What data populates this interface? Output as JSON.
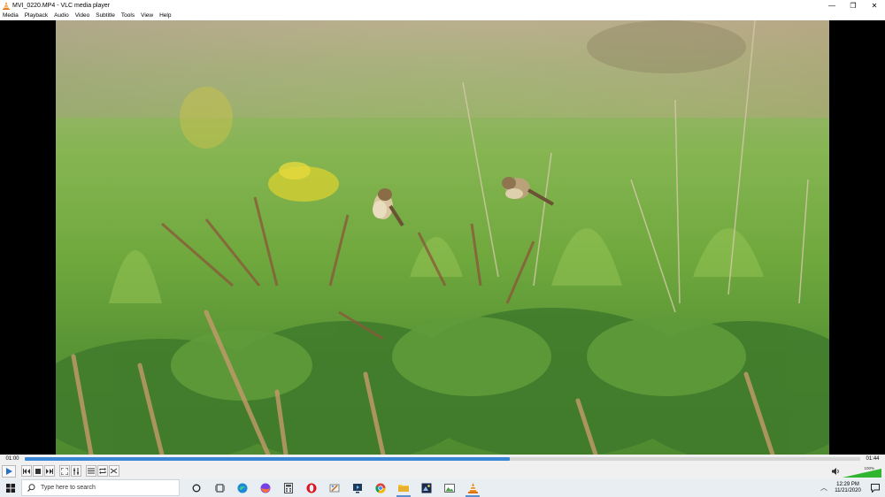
{
  "window": {
    "title": "MVI_0220.MP4 - VLC media player",
    "controls": {
      "minimize": "—",
      "restore": "❐",
      "close": "✕"
    }
  },
  "menu": [
    "Media",
    "Playback",
    "Audio",
    "Video",
    "Subtitle",
    "Tools",
    "View",
    "Help"
  ],
  "player": {
    "elapsed": "01:00",
    "total": "01:44",
    "progress_fraction": 0.58,
    "volume_label": "100%",
    "volume_fraction": 1.0,
    "accent_color": "#3a86d6"
  },
  "taskbar": {
    "search_placeholder": "Type here to search",
    "time": "12:29 PM",
    "date": "11/21/2020",
    "pinned": [
      "cortana-icon",
      "task-view-icon",
      "edge-icon",
      "firefox-icon",
      "calculator-icon",
      "opera-icon",
      "paint-icon",
      "media-app-icon",
      "chrome-icon",
      "file-explorer-icon",
      "photo-app-icon",
      "image-viewer-icon",
      "vlc-icon"
    ]
  }
}
